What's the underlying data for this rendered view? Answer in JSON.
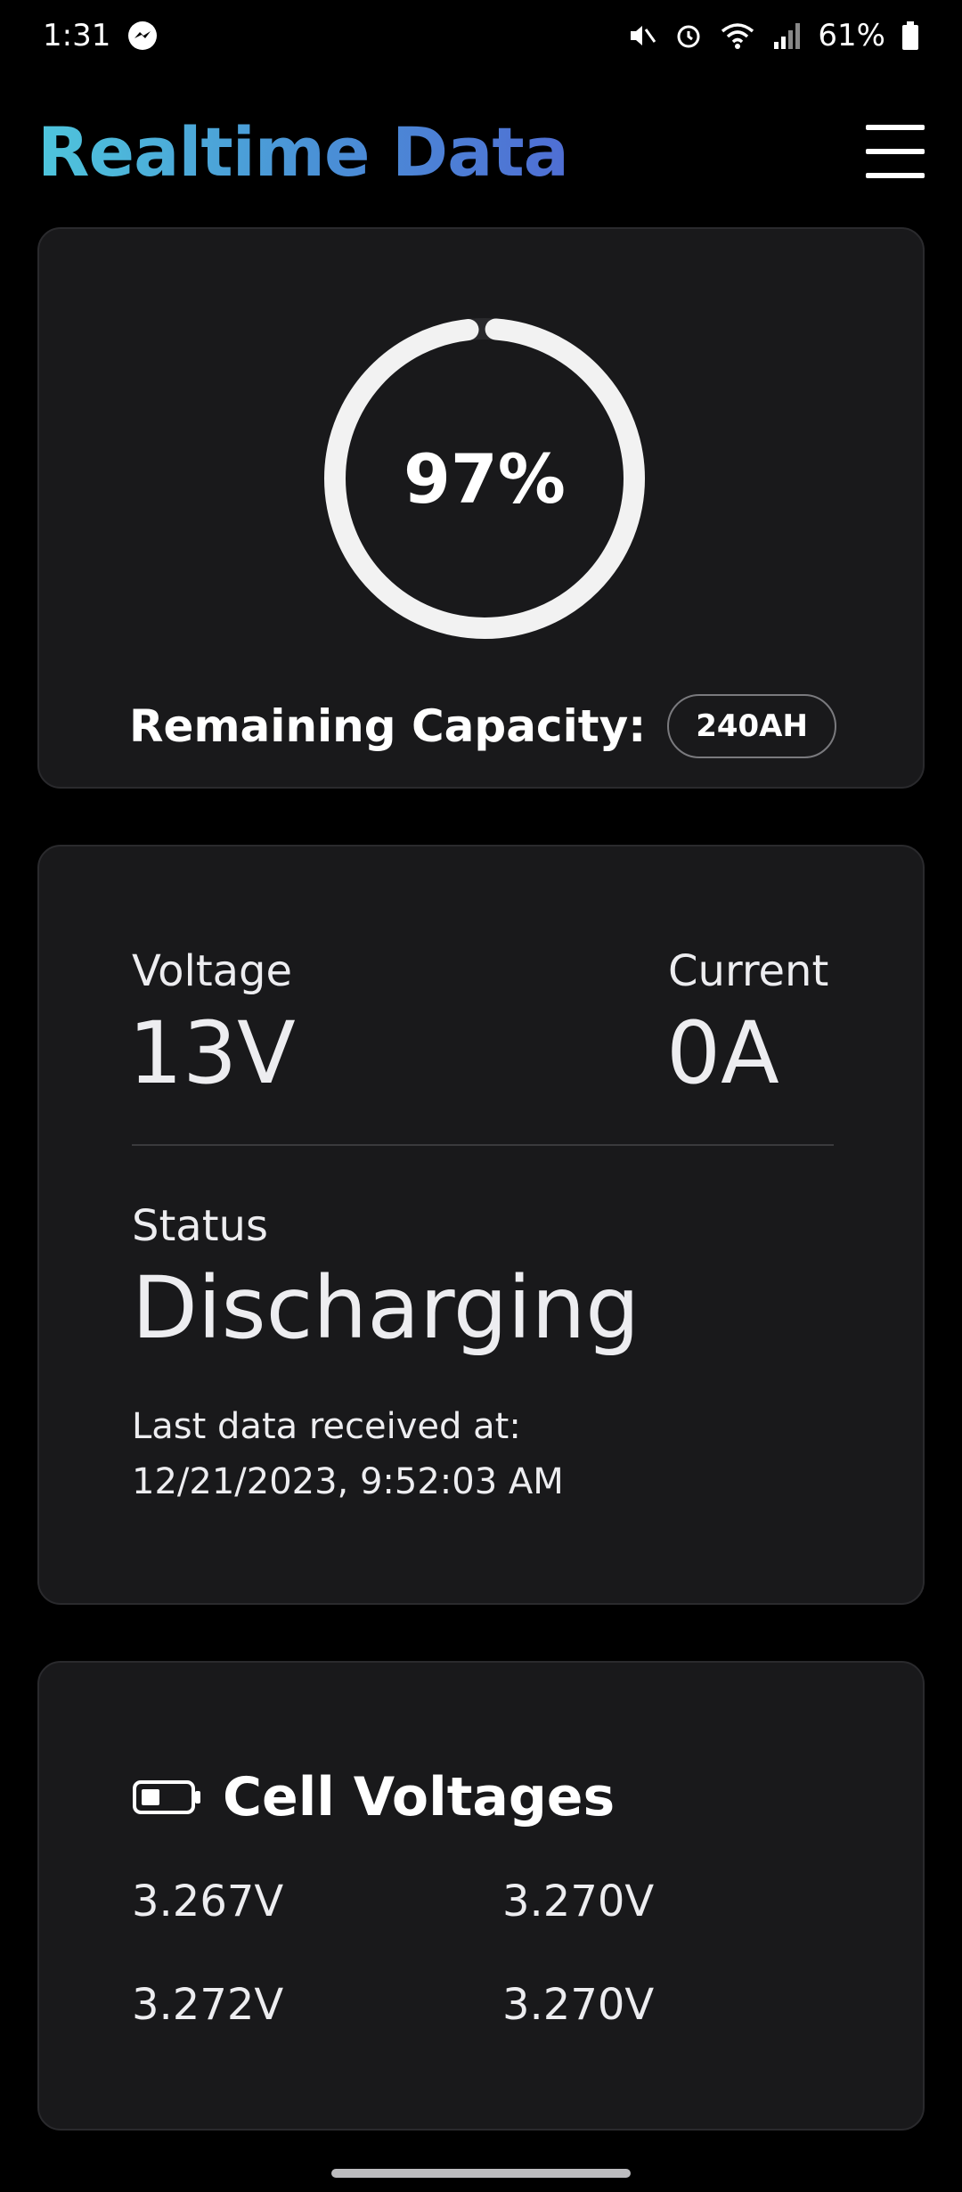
{
  "status_bar": {
    "time": "1:31",
    "battery_percent": "61%"
  },
  "header": {
    "title": "Realtime Data"
  },
  "capacity": {
    "percent_label": "97%",
    "percent_value": 97,
    "label": "Remaining Capacity:",
    "badge": "240AH"
  },
  "metrics": {
    "voltage_label": "Voltage",
    "voltage_value": "13V",
    "current_label": "Current",
    "current_value": "0A",
    "status_label": "Status",
    "status_value": "Discharging",
    "last_received_label": "Last data received at:",
    "last_received_time": "12/21/2023, 9:52:03 AM"
  },
  "cells": {
    "title": "Cell Voltages",
    "values": [
      "3.267V",
      "3.270V",
      "3.272V",
      "3.270V"
    ]
  },
  "colors": {
    "accent_start": "#4ec5dc",
    "accent_end": "#4f6ed4",
    "card_bg": "#19191b",
    "background": "#000000"
  }
}
